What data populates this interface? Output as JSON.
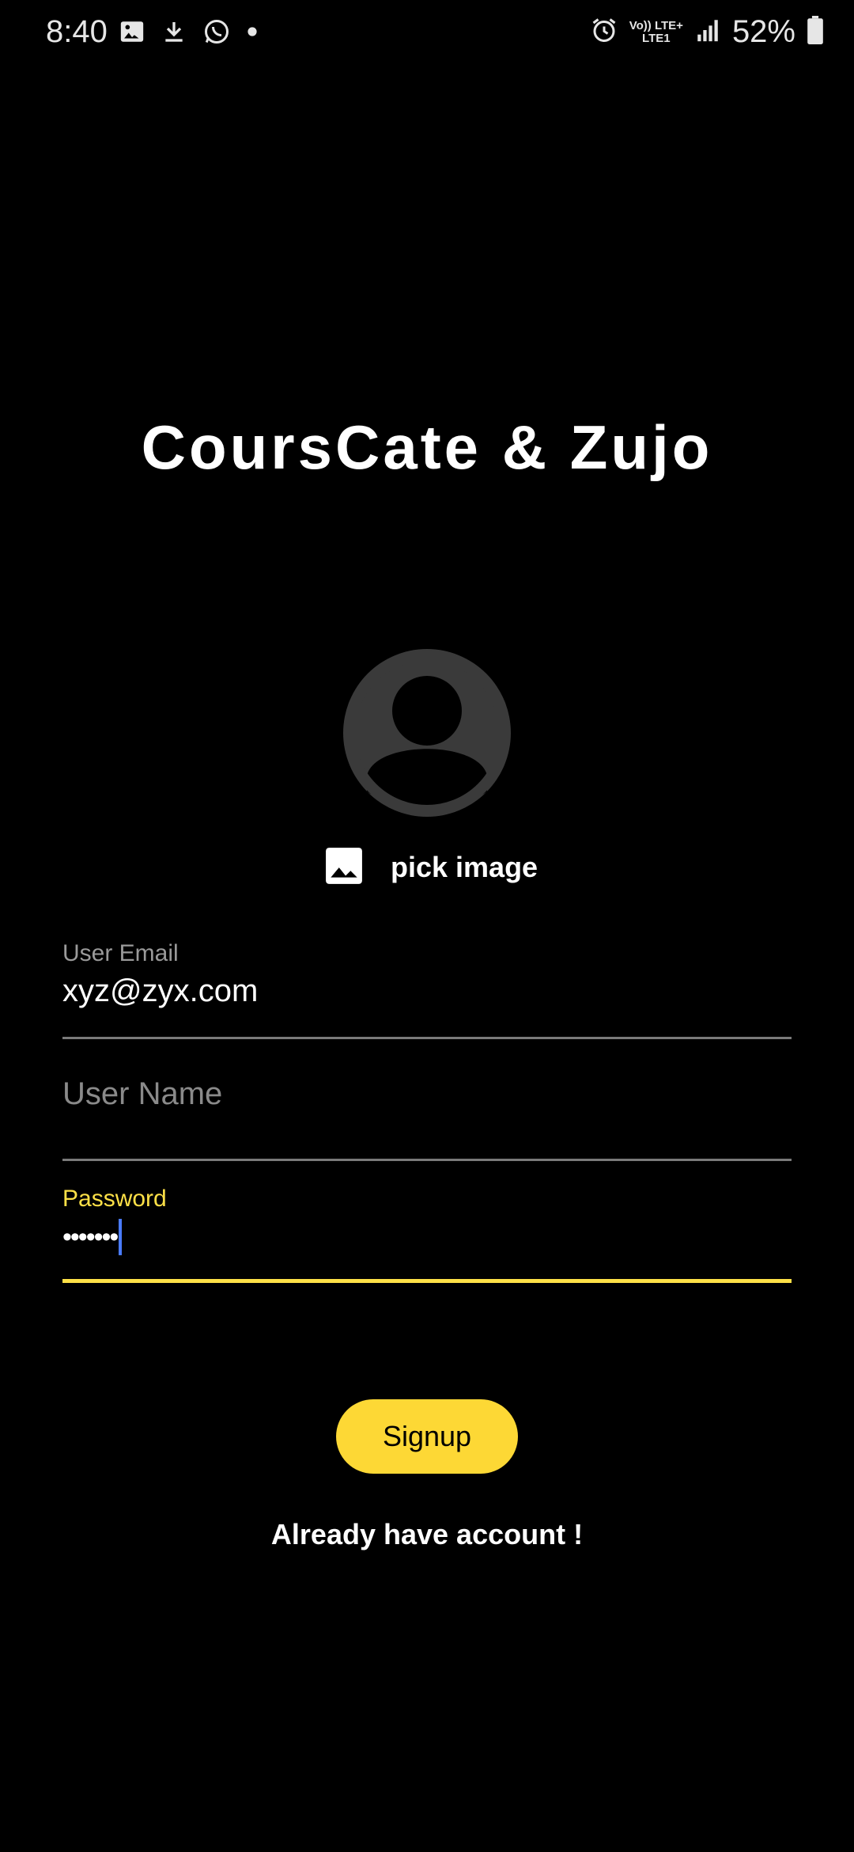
{
  "status_bar": {
    "time": "8:40",
    "battery": "52%",
    "network_top": "Vo)) LTE+",
    "network_bottom": "LTE1",
    "left_icons": [
      "gallery-icon",
      "download-icon",
      "whatsapp-icon",
      "dot-icon"
    ],
    "right_icons": [
      "alarm-icon",
      "signal-icon",
      "battery-icon"
    ]
  },
  "app": {
    "title": "CoursCate & Zujo"
  },
  "avatar": {
    "icon": "person-icon"
  },
  "pick_image": {
    "label": "pick image",
    "icon": "image-icon"
  },
  "form": {
    "email": {
      "label": "User Email",
      "value": "xyz@zyx.com"
    },
    "username": {
      "placeholder": "User Name"
    },
    "password": {
      "label": "Password",
      "value": "•••••••"
    }
  },
  "actions": {
    "signup_label": "Signup",
    "login_link": "Already have account !"
  },
  "colors": {
    "accent": "#fdd835",
    "background": "#000000",
    "avatar_bg": "#3a3a3a",
    "caret": "#4a7bff"
  }
}
